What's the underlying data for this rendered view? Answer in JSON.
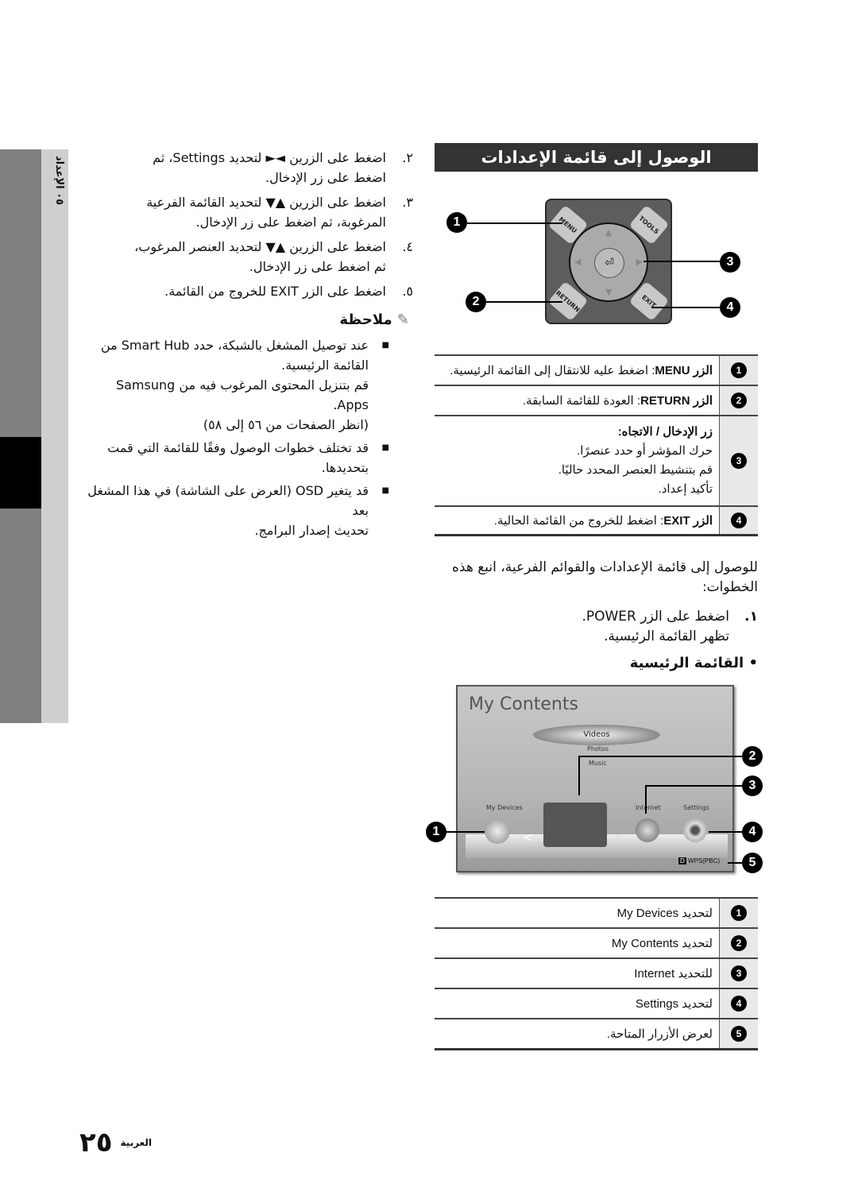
{
  "sidebar": {
    "chapter_label": "٠٥  الإعداد"
  },
  "section": {
    "title": "الوصول إلى قائمة الإعدادات"
  },
  "remote": {
    "buttons": {
      "menu": "MENU",
      "tools": "TOOLS",
      "return": "RETURN",
      "exit": "EXIT"
    },
    "callouts": [
      "1",
      "2",
      "3",
      "4"
    ]
  },
  "remote_table": [
    {
      "num": "1",
      "key": "الزر MENU",
      "text": ": اضغط عليه للانتقال إلى القائمة الرئيسية."
    },
    {
      "num": "2",
      "key": "الزر RETURN",
      "text": ": العودة للقائمة السابقة."
    },
    {
      "num": "3",
      "key": "زر الإدخال / الاتجاه:",
      "lines": [
        "حرك المؤشر أو حدد عنصرًا.",
        "قم بتنشيط العنصر المحدد حاليًا.",
        "تأكيد إعداد."
      ]
    },
    {
      "num": "4",
      "key": "الزر EXIT",
      "text": ": اضغط للخروج من القائمة الحالية."
    }
  ],
  "intro": {
    "text": "للوصول إلى قائمة الإعدادات والقوائم الفرعية، انبع هذه الخطوات:",
    "step1_num": "١.",
    "step1": "اضغط على الزر POWER.",
    "step1_sub": "تظهر القائمة الرئيسية.",
    "bullet_title": "• القائمة الرئيسية"
  },
  "screen": {
    "title": "My Contents",
    "menu": [
      "Videos",
      "Photos",
      "Music"
    ],
    "items": [
      "My Devices",
      "Internet",
      "Settings"
    ],
    "wps": "WPS(PBC)",
    "wps_key": "D",
    "callouts": [
      "1",
      "2",
      "3",
      "4",
      "5"
    ]
  },
  "home_table": [
    {
      "num": "1",
      "text": "لتحديد My Devices"
    },
    {
      "num": "2",
      "text": "لتحديد My Contents"
    },
    {
      "num": "3",
      "text": "للتحديد Internet"
    },
    {
      "num": "4",
      "text": "لتحديد Settings"
    },
    {
      "num": "5",
      "text": "لعرض الأزرار المتاحة."
    }
  ],
  "steps": [
    {
      "num": "٢.",
      "lines": [
        "اضغط على الزرين ◄► لتحديد Settings، ثم",
        "اضغط على زر الإدخال."
      ]
    },
    {
      "num": "٣.",
      "lines": [
        "اضغط على الزرين ▲▼ لتحديد القائمة الفرعية",
        "المرغوبة، ثم اضغط على زر الإدخال."
      ]
    },
    {
      "num": "٤.",
      "lines": [
        "اضغط على الزرين ▲▼ لتحديد العنصر المرغوب،",
        "ثم اضغط على زر الإدخال."
      ]
    },
    {
      "num": "٥.",
      "lines": [
        "اضغط على الزر EXIT للخروج من القائمة."
      ]
    }
  ],
  "note": {
    "title": "ملاحظة",
    "bullets": [
      {
        "lines": [
          "عند توصيل المشغل بالشبكة، حدد Smart Hub من",
          "القائمة الرئيسية.",
          "قم بتنزيل المحتوى المرغوب فيه من Samsung Apps.",
          "(انظر الصفحات من ٥٦ إلى ٥٨)"
        ]
      },
      {
        "lines": [
          "قد تختلف خطوات الوصول وفقًا للقائمة التي قمت",
          "بتحديدها."
        ]
      },
      {
        "lines": [
          "قد يتغير OSD (العرض على الشاشة) في هذا المشغل بعد",
          "تحديث إصدار البرامج."
        ]
      }
    ]
  },
  "footer": {
    "page_number": "٢٥",
    "language": "العربية"
  }
}
